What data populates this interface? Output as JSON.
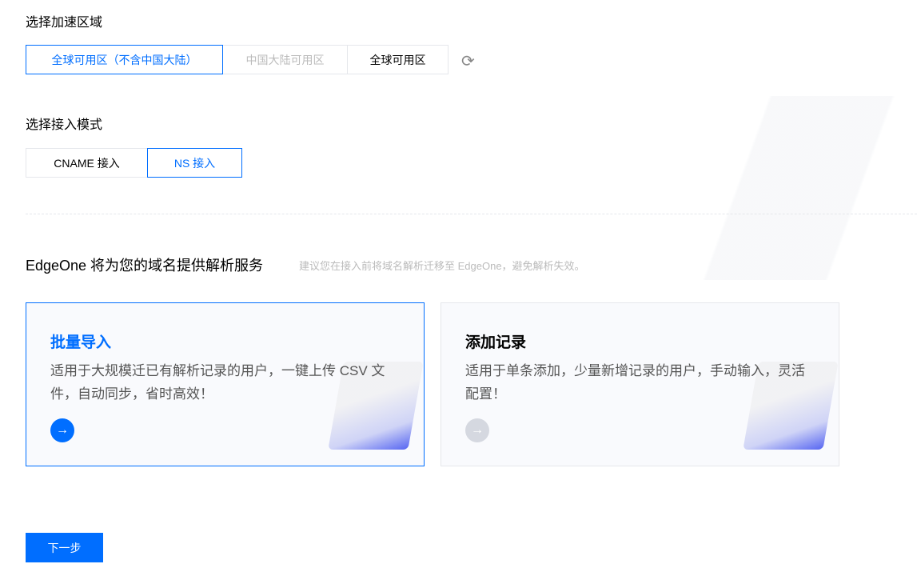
{
  "region": {
    "label": "选择加速区域",
    "options": [
      "全球可用区（不含中国大陆）",
      "中国大陆可用区",
      "全球可用区"
    ],
    "selected": 0
  },
  "mode": {
    "label": "选择接入模式",
    "options": [
      "CNAME 接入",
      "NS 接入"
    ],
    "selected": 1
  },
  "dns": {
    "title": "EdgeOne 将为您的域名提供解析服务",
    "hint": "建议您在接入前将域名解析迁移至 EdgeOne，避免解析失效。"
  },
  "cards": [
    {
      "title": "批量导入",
      "desc": "适用于大规模迁已有解析记录的用户，一键上传 CSV 文件，自动同步，省时高效！"
    },
    {
      "title": "添加记录",
      "desc": "适用于单条添加，少量新增记录的用户，手动输入，灵活配置！"
    }
  ],
  "next": "下一步"
}
